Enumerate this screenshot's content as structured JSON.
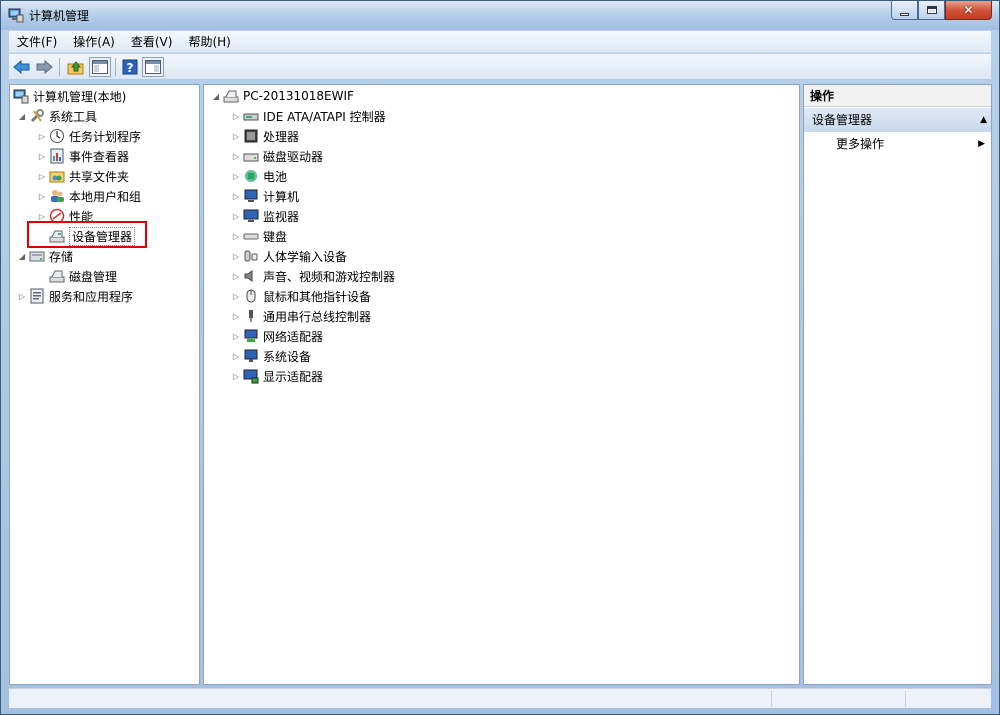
{
  "window": {
    "title": "计算机管理"
  },
  "menu": [
    "文件(F)",
    "操作(A)",
    "查看(V)",
    "帮助(H)"
  ],
  "toolbar": {
    "buttons": [
      "back-icon",
      "forward-icon",
      "up-folder-icon",
      "show-hide-console-tree-icon",
      "help-icon",
      "show-hide-action-pane-icon"
    ]
  },
  "left_tree": {
    "root": "计算机管理(本地)",
    "system_tools": "系统工具",
    "task_scheduler": "任务计划程序",
    "event_viewer": "事件查看器",
    "shared_folders": "共享文件夹",
    "local_users": "本地用户和组",
    "performance": "性能",
    "device_manager": "设备管理器",
    "storage": "存储",
    "disk_management": "磁盘管理",
    "services_apps": "服务和应用程序"
  },
  "device_tree": {
    "computer": "PC-20131018EWIF",
    "categories": [
      "IDE ATA/ATAPI 控制器",
      "处理器",
      "磁盘驱动器",
      "电池",
      "计算机",
      "监视器",
      "键盘",
      "人体学输入设备",
      "声音、视频和游戏控制器",
      "鼠标和其他指针设备",
      "通用串行总线控制器",
      "网络适配器",
      "系统设备",
      "显示适配器"
    ]
  },
  "actions": {
    "title": "操作",
    "section": "设备管理器",
    "more": "更多操作"
  },
  "colors": {
    "highlight_box": "#e00000",
    "titlebar": "#b8cfe9",
    "close_button": "#c23b22"
  }
}
